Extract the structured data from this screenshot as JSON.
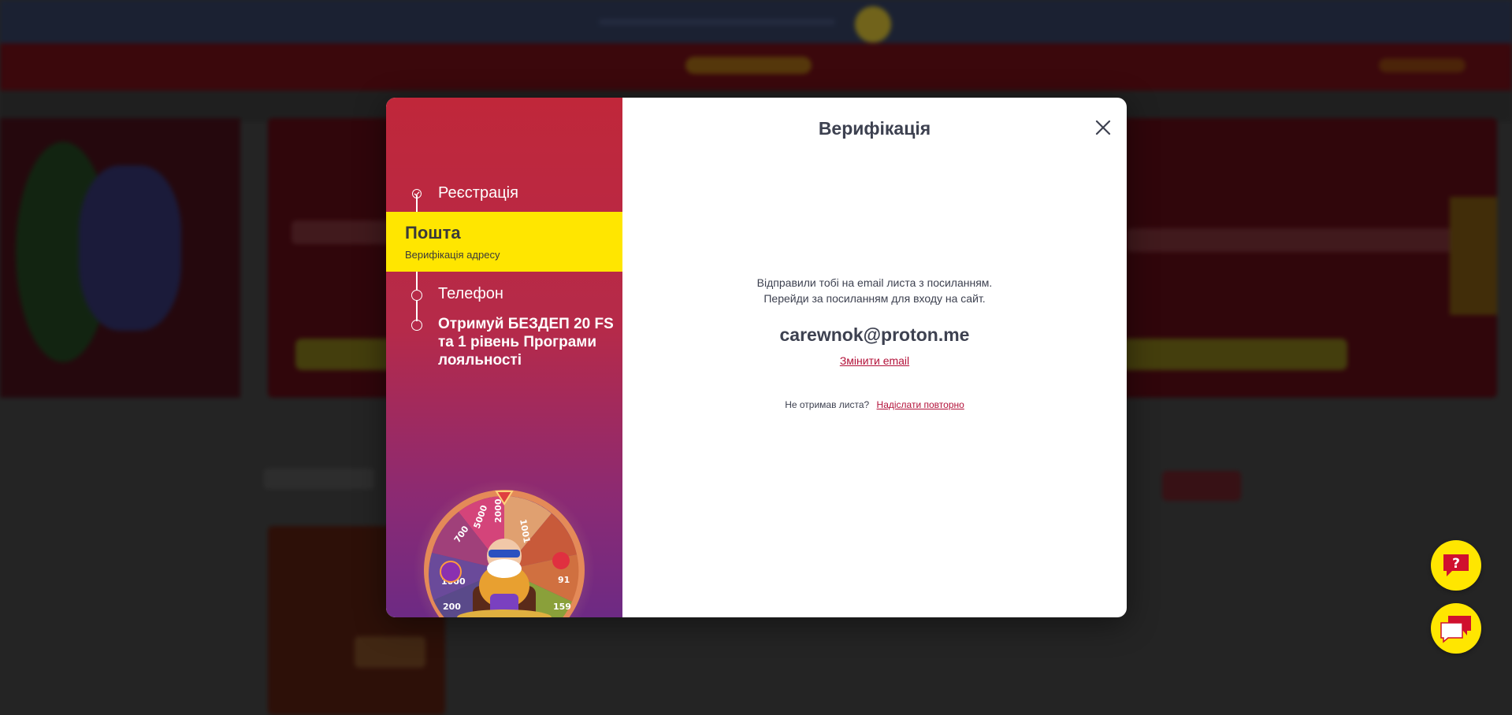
{
  "modal": {
    "title": "Верифікація",
    "steps": [
      {
        "label": "Реєстрація",
        "status": "done"
      },
      {
        "label": "Пошта",
        "sublabel": "Верифікація адресу",
        "status": "active"
      },
      {
        "label": "Телефон",
        "status": "pending"
      },
      {
        "label": "Отримуй БЕЗДЕП 20 FS та 1 рівень Програми лояльності",
        "status": "pending"
      }
    ],
    "message_line1": "Відправили тобі на email листа з посиланням.",
    "message_line2": "Перейди за посиланням для входу на сайт.",
    "email": "carewnok@proton.me",
    "change_email_link": "Змінити email",
    "not_received_text": "Не отримав листа?",
    "resend_link": "Надіслати повторно",
    "wheel_labels": [
      "700",
      "5000",
      "2000",
      "1001",
      "200",
      "1000",
      "200",
      "159",
      "91"
    ]
  },
  "colors": {
    "accent_yellow": "#ffe600",
    "brand_red": "#c0273a",
    "link_red": "#b3123a",
    "text_dark": "#3d4150"
  },
  "icons": {
    "close": "close-icon",
    "help": "question-mark-icon",
    "chat": "chat-bubble-icon",
    "check": "check-icon"
  }
}
